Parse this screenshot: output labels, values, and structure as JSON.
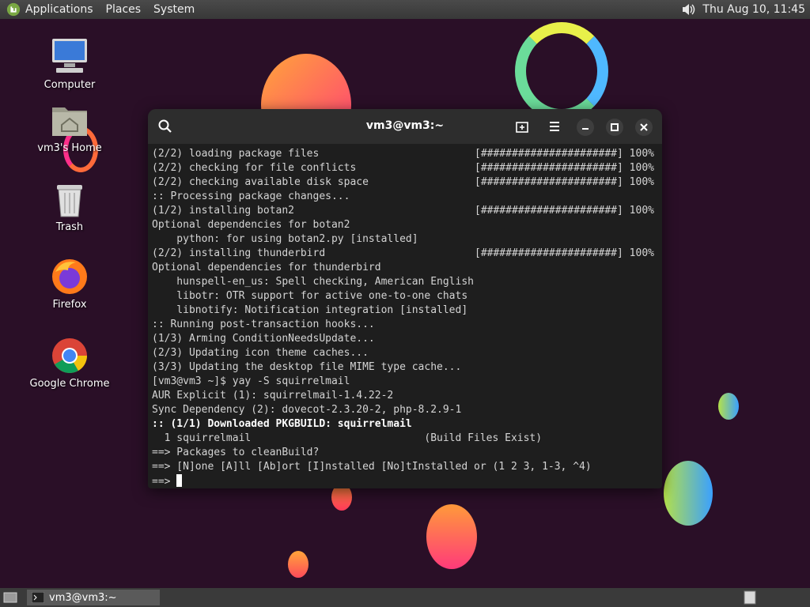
{
  "top_panel": {
    "menus": [
      "Applications",
      "Places",
      "System"
    ],
    "clock": "Thu Aug 10, 11:45",
    "logo_icon": "mint-logo-icon",
    "volume_icon": "speaker-icon"
  },
  "desktop_icons": [
    {
      "label": "Computer",
      "icon": "computer-icon"
    },
    {
      "label": "vm3's Home",
      "icon": "home-folder-icon"
    },
    {
      "label": "Trash",
      "icon": "trash-icon"
    },
    {
      "label": "Firefox",
      "icon": "firefox-icon"
    },
    {
      "label": "Google Chrome",
      "icon": "chrome-icon"
    }
  ],
  "terminal": {
    "title": "vm3@vm3:~",
    "lines": [
      {
        "text": "(2/2) loading package files",
        "right": "[######################] 100%"
      },
      {
        "text": "(2/2) checking for file conflicts",
        "right": "[######################] 100%"
      },
      {
        "text": "(2/2) checking available disk space",
        "right": "[######################] 100%"
      },
      {
        "text": ":: Processing package changes...",
        "right": ""
      },
      {
        "text": "(1/2) installing botan2",
        "right": "[######################] 100%"
      },
      {
        "text": "Optional dependencies for botan2",
        "right": ""
      },
      {
        "text": "    python: for using botan2.py [installed]",
        "right": ""
      },
      {
        "text": "(2/2) installing thunderbird",
        "right": "[######################] 100%"
      },
      {
        "text": "Optional dependencies for thunderbird",
        "right": ""
      },
      {
        "text": "    hunspell-en_us: Spell checking, American English",
        "right": ""
      },
      {
        "text": "    libotr: OTR support for active one-to-one chats",
        "right": ""
      },
      {
        "text": "    libnotify: Notification integration [installed]",
        "right": ""
      },
      {
        "text": ":: Running post-transaction hooks...",
        "right": ""
      },
      {
        "text": "(1/3) Arming ConditionNeedsUpdate...",
        "right": ""
      },
      {
        "text": "(2/3) Updating icon theme caches...",
        "right": ""
      },
      {
        "text": "(3/3) Updating the desktop file MIME type cache...",
        "right": ""
      },
      {
        "text": "[vm3@vm3 ~]$ yay -S squirrelmail",
        "right": ""
      },
      {
        "text": "AUR Explicit (1): squirrelmail-1.4.22-2",
        "right": ""
      },
      {
        "text": "Sync Dependency (2): dovecot-2.3.20-2, php-8.2.9-1",
        "right": ""
      },
      {
        "text": ":: (1/1) Downloaded PKGBUILD: squirrelmail",
        "right": "",
        "bold": true
      },
      {
        "text": "  1 squirrelmail                            (Build Files Exist)",
        "right": ""
      },
      {
        "text": "==> Packages to cleanBuild?",
        "right": ""
      },
      {
        "text": "==> [N]one [A]ll [Ab]ort [I]nstalled [No]tInstalled or (1 2 3, 1-3, ^4)",
        "right": ""
      },
      {
        "text": "==> ",
        "right": "",
        "cursor": true
      }
    ]
  },
  "bottom_panel": {
    "task_label": "vm3@vm3:~"
  }
}
